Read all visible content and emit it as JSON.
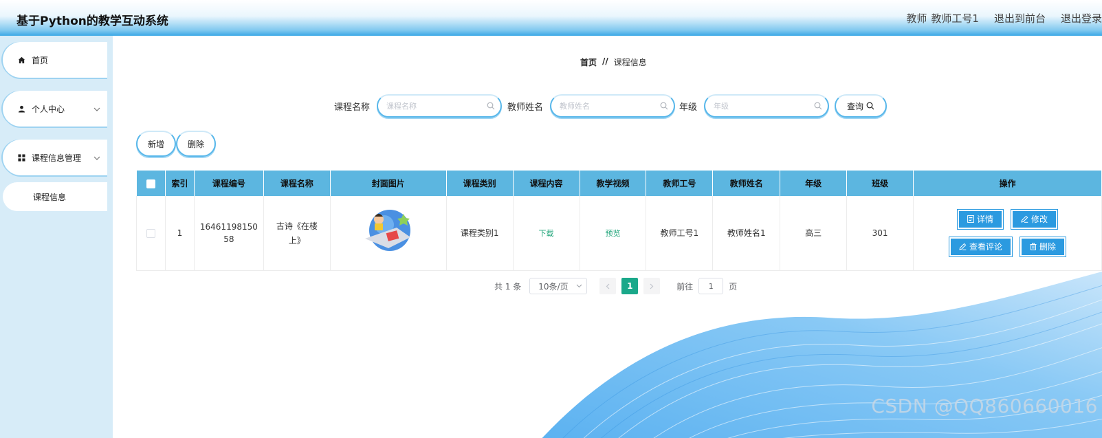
{
  "header": {
    "title": "基于Python的教学互动系统",
    "user_role": "教师",
    "user_name": "教师工号1",
    "exit_front": "退出到前台",
    "logout": "退出登录"
  },
  "sidebar": {
    "items": [
      {
        "label": "首页",
        "icon": "home-icon"
      },
      {
        "label": "个人中心",
        "icon": "user-icon",
        "expandable": true
      },
      {
        "label": "课程信息管理",
        "icon": "grid-icon",
        "expandable": true
      }
    ],
    "sub_item": "课程信息"
  },
  "breadcrumb": {
    "home": "首页",
    "separator": "//",
    "current": "课程信息"
  },
  "search": {
    "course_name_label": "课程名称",
    "course_name_placeholder": "课程名称",
    "teacher_name_label": "教师姓名",
    "teacher_name_placeholder": "教师姓名",
    "grade_label": "年级",
    "grade_placeholder": "年级",
    "query_label": "查询"
  },
  "actions": {
    "add": "新增",
    "delete": "删除"
  },
  "table": {
    "headers": [
      "索引",
      "课程编号",
      "课程名称",
      "封面图片",
      "课程类别",
      "课程内容",
      "教学视频",
      "教师工号",
      "教师姓名",
      "年级",
      "班级",
      "操作"
    ],
    "rows": [
      {
        "index": "1",
        "course_no_line1": "16461198150",
        "course_no_line2": "58",
        "course_name_line1": "古诗《在楼",
        "course_name_line2": "上》",
        "category": "课程类别1",
        "content": "下载",
        "video": "预览",
        "teacher_no": "教师工号1",
        "teacher_name": "教师姓名1",
        "grade": "高三",
        "class": "301",
        "ops": {
          "detail": "详情",
          "edit": "修改",
          "comments": "查看评论",
          "delete": "删除"
        }
      }
    ]
  },
  "pagination": {
    "total": "共 1 条",
    "page_size": "10条/页",
    "current_page": "1",
    "goto_label": "前往",
    "goto_value": "1",
    "page_suffix": "页"
  },
  "watermark": "CSDN @QQ860660016",
  "colors": {
    "accent": "#5cb6e0",
    "button": "#2b9ae0",
    "active_page": "#1aa88a",
    "link": "#21a57a",
    "sidebar_bg": "#d7ecf8"
  }
}
